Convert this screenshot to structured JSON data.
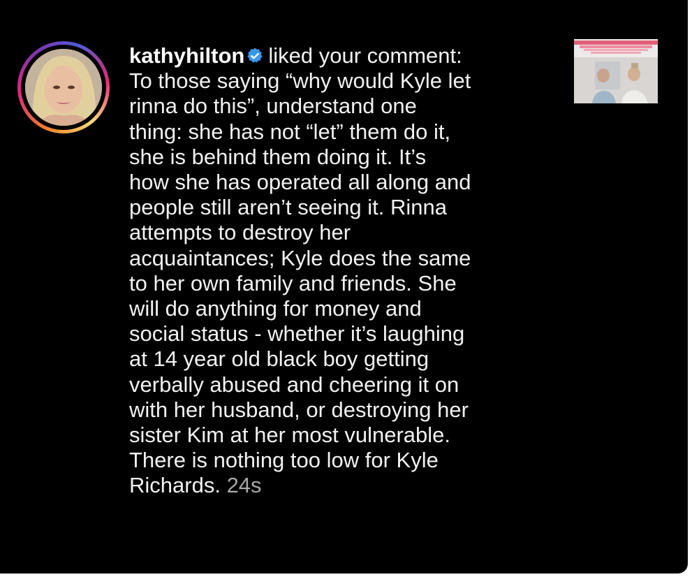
{
  "notification": {
    "username": "kathyhilton",
    "verified_icon": "verified-badge-icon",
    "action": "liked your comment:",
    "comment_lines": [
      "To those saying “why would Kyle let",
      "rinna do this”, understand one",
      "thing: she has not “let” them do it,",
      "she is behind them doing it. It’s",
      "how she has operated all along and",
      "people still aren’t seeing it. Rinna",
      "attempts to destroy her",
      "acquaintances; Kyle does the same",
      "to her own family and friends. She",
      "will do anything for money and",
      "social status - whether it’s laughing",
      "at 14 year old black boy getting",
      "verbally abused and cheering it on",
      "with her husband, or destroying her",
      "sister Kim at her most vulnerable.",
      "There is nothing too low for Kyle"
    ],
    "last_line": "Richards.",
    "timestamp": "24s",
    "colors": {
      "background": "#000000",
      "text": "#f2f2f2",
      "timestamp": "#a8a8a8",
      "verified": "#3897f0",
      "story_ring": "#dd2a7b"
    }
  }
}
